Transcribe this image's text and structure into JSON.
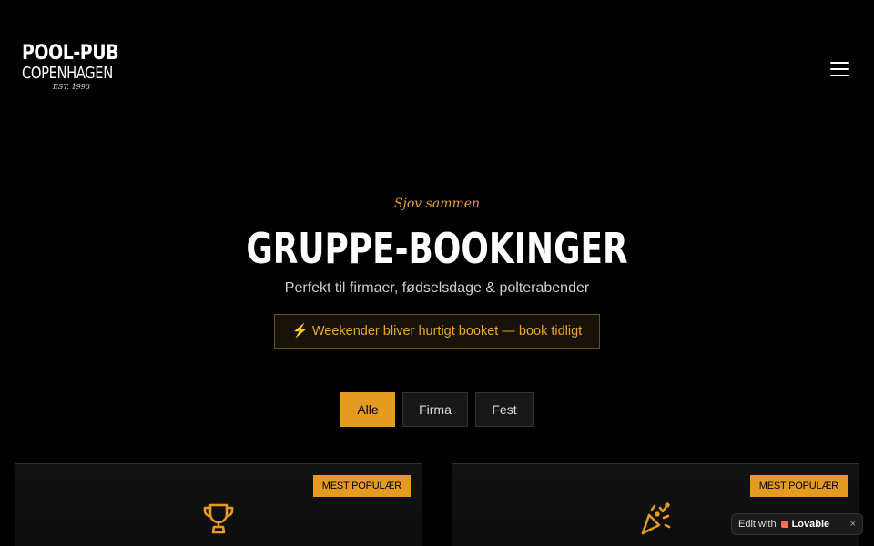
{
  "header": {
    "logo": {
      "line1": "POOL-PUB",
      "line2": "COPENHAGEN",
      "line3": "EST. 1993"
    },
    "menu_icon": "hamburger-menu-icon"
  },
  "hero": {
    "tagline": "Sjov sammen",
    "title": "GRUPPE-BOOKINGER",
    "subtitle": "Perfekt til firmaer, fødselsdage & polterabender",
    "notice": "⚡ Weekender bliver hurtigt booket — book tidligt"
  },
  "filters": [
    {
      "label": "Alle",
      "active": true
    },
    {
      "label": "Firma",
      "active": false
    },
    {
      "label": "Fest",
      "active": false
    }
  ],
  "cards": [
    {
      "badge": "MEST POPULÆR",
      "icon": "trophy-icon"
    },
    {
      "badge": "MEST POPULÆR",
      "icon": "party-popper-icon"
    }
  ],
  "lovable_badge": {
    "prefix": "Edit with",
    "brand": "Lovable",
    "close": "×"
  },
  "colors": {
    "accent": "#e59a20",
    "background": "#000000",
    "text": "#ffffff"
  }
}
